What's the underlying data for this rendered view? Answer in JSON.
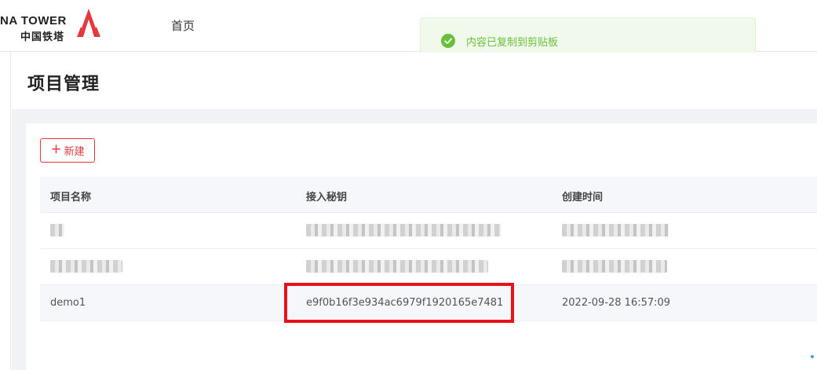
{
  "header": {
    "logo_en": "NA TOWER",
    "logo_cn": "中国铁塔",
    "nav_home": "首页"
  },
  "toast": {
    "message": "内容已复制到剪贴板",
    "type": "success"
  },
  "page": {
    "title": "项目管理"
  },
  "toolbar": {
    "new_label": "新建",
    "new_icon": "plus-icon"
  },
  "table": {
    "columns": [
      "项目名称",
      "接入秘钥",
      "创建时间"
    ],
    "rows": [
      {
        "name": "",
        "key": "",
        "created": "",
        "redacted": true
      },
      {
        "name": "",
        "key": "",
        "created": "",
        "redacted": true
      },
      {
        "name": "demo1",
        "key": "e9f0b16f3e934ac6979f1920165e7481",
        "created": "2022-09-28 16:57:09"
      }
    ]
  },
  "colors": {
    "brand_red": "#e4393c",
    "highlight_box": "#e8111b",
    "toast_bg": "#f0f9eb",
    "toast_text": "#67c23a"
  }
}
